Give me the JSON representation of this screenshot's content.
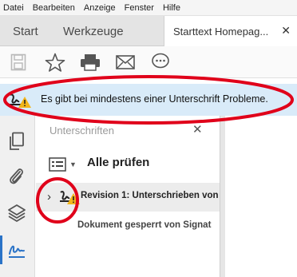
{
  "menu": {
    "items": [
      "Datei",
      "Bearbeiten",
      "Anzeige",
      "Fenster",
      "Hilfe"
    ]
  },
  "tabs": {
    "start": "Start",
    "werkzeuge": "Werkzeuge",
    "document": "Starttext Homepag...",
    "close": "✕"
  },
  "toolbar": {
    "icons": [
      "save-icon",
      "star-icon",
      "print-icon",
      "mail-icon",
      "comment-icon"
    ]
  },
  "notification": {
    "text": "Es gibt bei mindestens einer Unterschrift Probleme.",
    "icon": "signature-warning-icon"
  },
  "rail": {
    "icons": [
      "pages-icon",
      "attachments-icon",
      "layers-icon",
      "signature-icon"
    ]
  },
  "panel": {
    "title": "Unterschriften",
    "close": "✕",
    "verify_all": "Alle prüfen",
    "revision_label": "Revision 1: Unterschrieben von",
    "revision_detail": "Dokument gesperrt von Signat"
  },
  "colors": {
    "notification_bg": "#d9ebf9",
    "annotation": "#e0001a",
    "warning": "#f2b51b",
    "accent": "#2a73c7"
  }
}
